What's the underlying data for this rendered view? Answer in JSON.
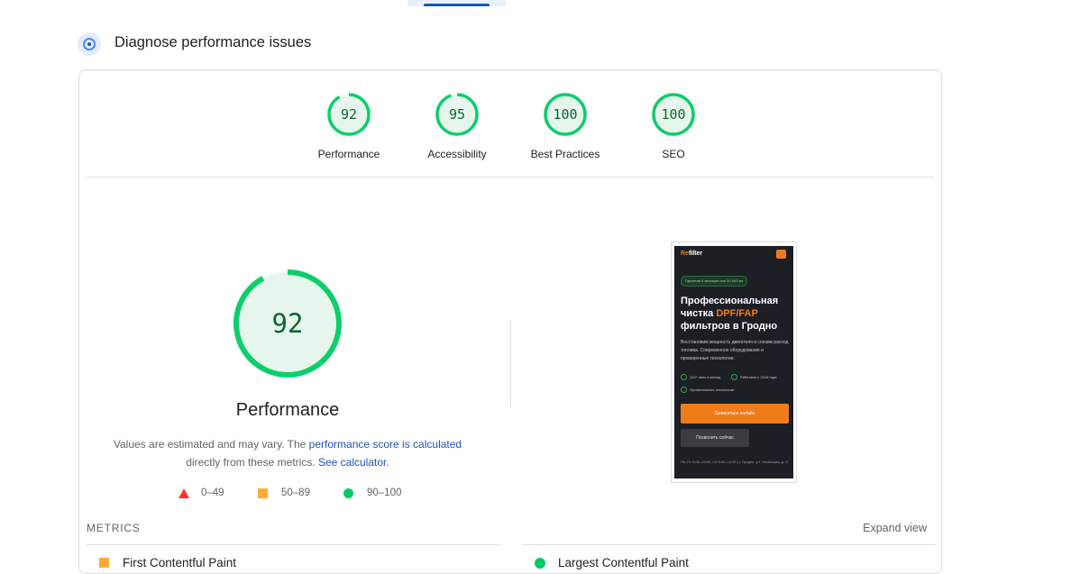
{
  "section": {
    "title": "Diagnose performance issues"
  },
  "categories": [
    {
      "score": 92,
      "label": "Performance"
    },
    {
      "score": 95,
      "label": "Accessibility"
    },
    {
      "score": 100,
      "label": "Best Practices"
    },
    {
      "score": 100,
      "label": "SEO"
    }
  ],
  "main": {
    "score": 92,
    "title": "Performance",
    "note_before": "Values are estimated and may vary. The ",
    "note_link1": "performance score is calculated",
    "note_middle": " directly from these metrics. ",
    "note_link2": "See calculator",
    "note_end": "."
  },
  "legend": {
    "fail": "0–49",
    "average": "50–89",
    "pass": "90–100"
  },
  "colors": {
    "pass": "#0cce6b",
    "average": "#ffa400",
    "fail": "#ff4e42",
    "link": "#1a56c0"
  },
  "screenshot": {
    "logo_pre": "Re",
    "logo_post": "filter",
    "badge": "Гарантия 6 месяцев или 50 000 км",
    "heading_pre": "Профессиональная чистка ",
    "heading_accent": "DPF/FAP",
    "heading_post": " фильтров в Гродно",
    "paragraph": "Восстановим мощность двигателя и снизим расход топлива. Современное оборудование и проверенные технологии.",
    "feature1": "120+ авто в месяц",
    "feature2": "Работаем с 2016 года",
    "feature3": "Оригинальные технологии",
    "button_primary": "Записаться онлайн",
    "button_secondary": "Позвонить сейчас",
    "footer": "Пн–Пт 9:00–19:00, Сб 9:00–14:00 | г. Гродно, ул. Несенская, д. 5"
  },
  "metrics": {
    "header": "METRICS",
    "expand": "Expand view",
    "items": [
      {
        "label": "First Contentful Paint",
        "rating": "average"
      },
      {
        "label": "Largest Contentful Paint",
        "rating": "pass"
      }
    ]
  }
}
